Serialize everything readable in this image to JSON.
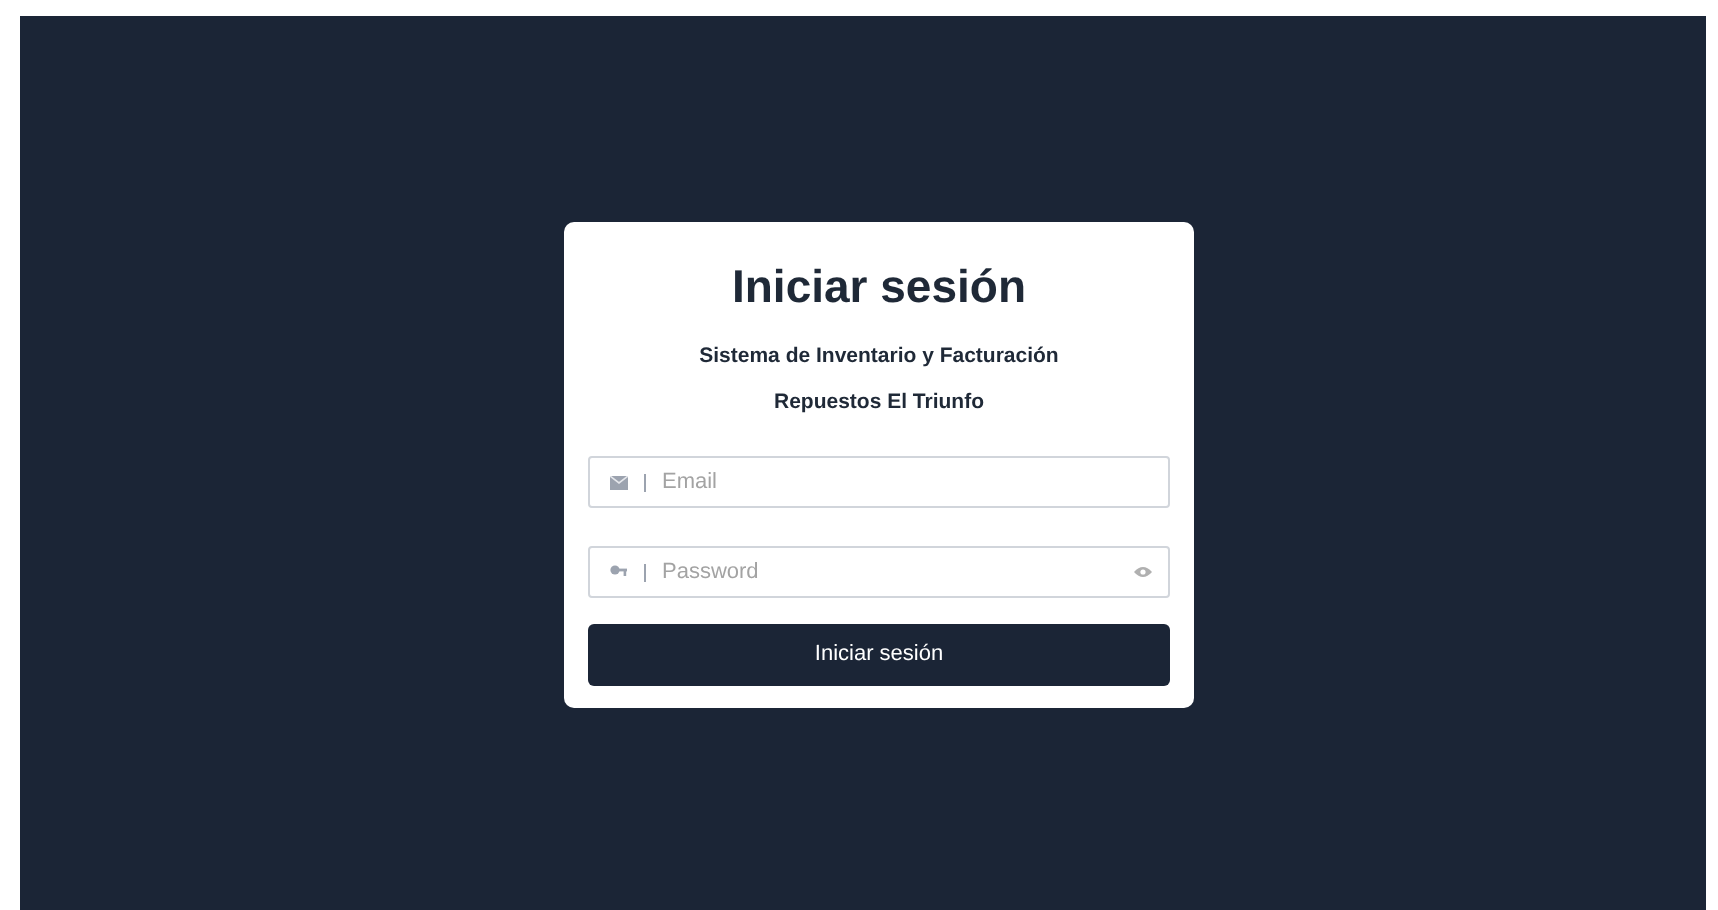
{
  "login": {
    "title": "Iniciar sesión",
    "subtitle": "Sistema de Inventario y Facturación",
    "company": "Repuestos El Triunfo",
    "fields": [
      {
        "kind": "email",
        "placeholder": "Email"
      },
      {
        "kind": "password",
        "placeholder": "Password"
      }
    ],
    "submit": "Iniciar sesión"
  }
}
